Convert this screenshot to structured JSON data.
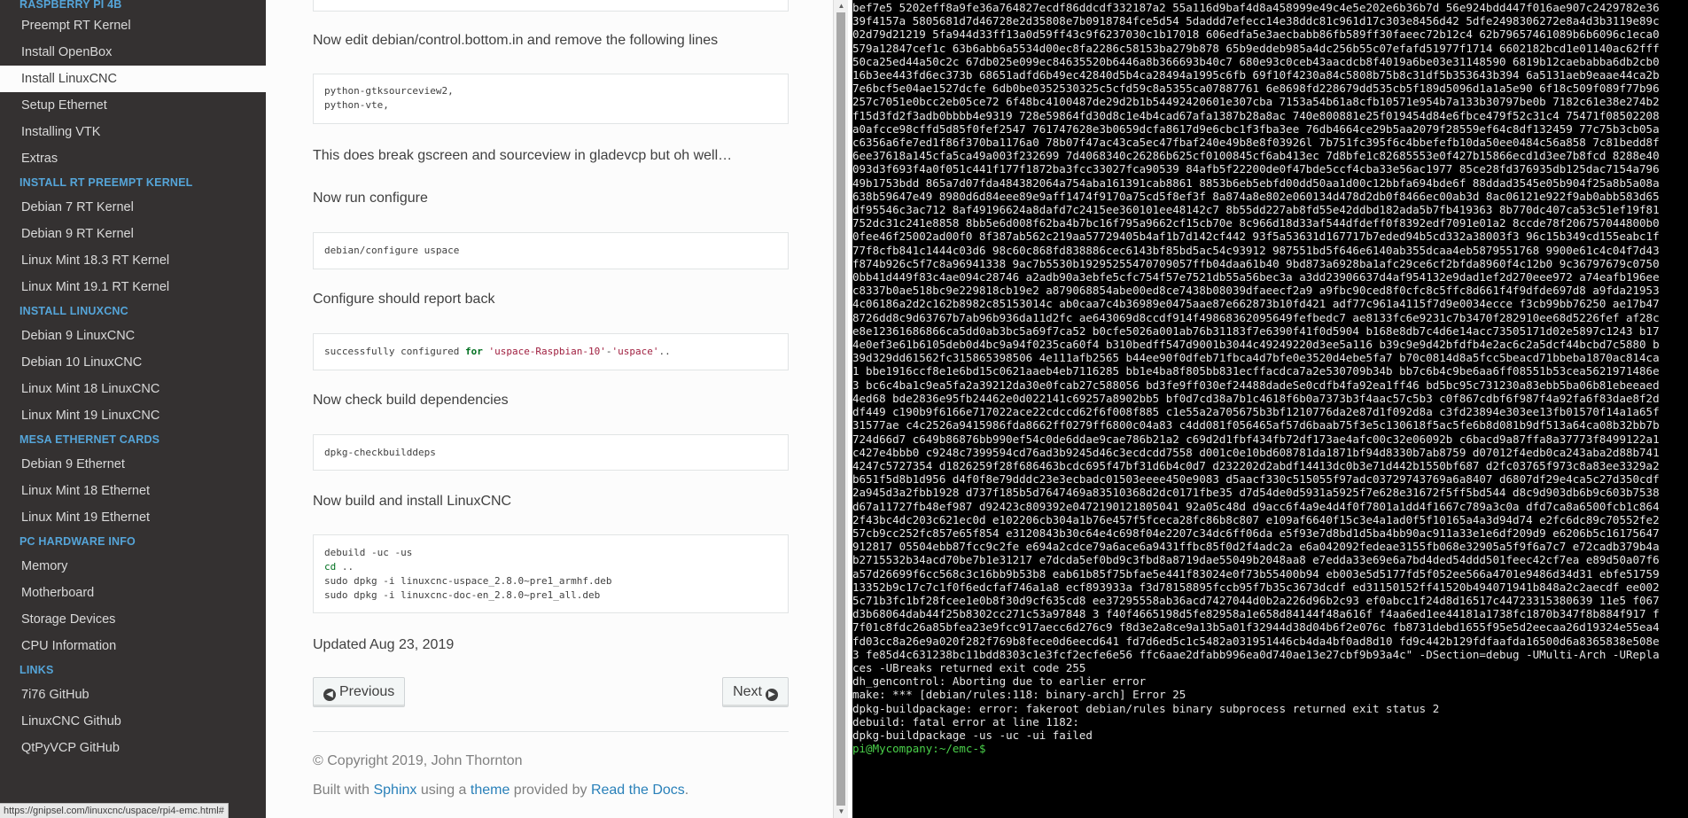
{
  "sidebar": {
    "sections": [
      {
        "caption": "Raspberry Pi 4B",
        "items": [
          {
            "label": "Preempt RT Kernel"
          },
          {
            "label": "Install OpenBox"
          },
          {
            "label": "Install LinuxCNC",
            "current": true
          },
          {
            "label": "Setup Ethernet"
          },
          {
            "label": "Installing VTK"
          },
          {
            "label": "Extras"
          }
        ]
      },
      {
        "caption": "Install RT PREEMPT Kernel",
        "items": [
          {
            "label": "Debian 7 RT Kernel"
          },
          {
            "label": "Debian 9 RT Kernel"
          },
          {
            "label": "Linux Mint 18.3 RT Kernel"
          },
          {
            "label": "Linux Mint 19.1 RT Kernel"
          }
        ]
      },
      {
        "caption": "Install LinuxCNC",
        "items": [
          {
            "label": "Debian 9 LinuxCNC"
          },
          {
            "label": "Debian 10 LinuxCNC"
          },
          {
            "label": "Linux Mint 18 LinuxCNC"
          },
          {
            "label": "Linux Mint 19 LinuxCNC"
          }
        ]
      },
      {
        "caption": "Mesa Ethernet Cards",
        "items": [
          {
            "label": "Debian 9 Ethernet"
          },
          {
            "label": "Linux Mint 18 Ethernet"
          },
          {
            "label": "Linux Mint 19 Ethernet"
          }
        ]
      },
      {
        "caption": "PC Hardware Info",
        "items": [
          {
            "label": "Memory"
          },
          {
            "label": "Motherboard"
          },
          {
            "label": "Storage Devices"
          },
          {
            "label": "CPU Information"
          }
        ]
      },
      {
        "caption": "Links",
        "items": [
          {
            "label": "7i76 GitHub"
          },
          {
            "label": "LinuxCNC Github"
          },
          {
            "label": "QtPyVCP GitHub"
          }
        ]
      }
    ]
  },
  "status_url": "https://gnipsel.com/linuxcnc/uspace/rpi4-emc.html#",
  "content": {
    "p_edit_control": "Now edit debian/control.bottom.in and remove the following lines",
    "code_remove": "python-gtksourceview2,\npython-vte,",
    "p_break": "This does break gscreen and sourceview in gladevcp but oh well…",
    "p_run_configure": "Now run configure",
    "code_configure": "debian/configure uspace",
    "p_report_back": "Configure should report back",
    "code_report": {
      "pre": "successfully configured ",
      "kw": "for",
      "s1": "'uspace-Raspbian-10'",
      "mid": "-",
      "s2": "'uspace'",
      "post": ".."
    },
    "p_check_deps": "Now check build dependencies",
    "code_check": "dpkg-checkbuilddeps",
    "p_build": "Now build and install LinuxCNC",
    "code_build": {
      "line1": "debuild -uc -us",
      "line2_kw": "cd",
      "line2_rest": " ..",
      "line3": "sudo dpkg -i linuxcnc-uspace_2.8.0~pre1_armhf.deb",
      "line4": "sudo dpkg -i linuxcnc-doc-en_2.8.0~pre1_all.deb"
    },
    "updated": "Updated Aug 23, 2019"
  },
  "nav": {
    "previous": "Previous",
    "next": "Next"
  },
  "footer": {
    "copyright": "© Copyright 2019, John Thornton",
    "built_with": "Built with ",
    "sphinx": "Sphinx",
    "using_a": " using a ",
    "theme": "theme",
    "provided_by": " provided by ",
    "rtd": "Read the Docs",
    "period": "."
  },
  "icons": {
    "previous": "circle-arrow-left-icon",
    "next": "circle-arrow-right-icon"
  },
  "colors": {
    "sidebar_bg": "#343131",
    "caption": "#55a5d9",
    "link": "#2980b9",
    "terminal_bg": "#000000",
    "prompt": "#4ad14a"
  },
  "terminal": {
    "hex": "bef7e5 5202eff8a9fe36a764827ecdf86ddcdf332187a2 55a116d9baf4d8a458999e49c4e5e202e6b36b7d 56e924bdd447f016ae907c2429782e3639f4157a 5805681d7d46728e2d35808e7b0918784fce5d54 5daddd7efecc14e38ddc81c961d17c303e8456d42 5dfe2498306272e8a4d3b3119e89c02d79d21219 5fa944d33ff13a0d59ff43c9f6237030c1b17018 606edfa5e3aecbabb86fb589ff30faeec72b12c4 62b79657461089b6b6096c1eca0579a12847cef1c 63b6abb6a5534d00ec8fa2286c58153ba279b878 65b9eddeb985a4dc256b55c07efafd51977f1714 6602182bcd1e01140ac62fff50ca25ed44a50c2c 67db025e099ec84635520b6446a8b366693b40c7 680e93c0ceb43aacdcb8f4019a6be03e31148590 6819b12caebabba6db2cb016b3ee443fd6ec373b 68651adfd6b49ec42840d5b4ca28494a1995c6fb 69f10f4230a84c5808b75b8c31df5b353643b394 6a5131aeb9eaae44ca2b7e6bcf5e04ae1527dcfe 6db0be0352530325c5cfd59c8a5355ca07887761 6e8698fd228679dd535cb5f189d5096d1a1a5e90 6f18c509f089f77b96257c7051e0bcc2eb05ce72 6f48bc4100487de29d2b1b54492420601e307cba 7153a54b61a8cfb10571e954b7a133b30797be0b 7182c61e38e274b2f15d3fd2f3adb0bbbb4e9319 728e59864fd30d8c1e4b4cad67afa1387b28a8ac 740e800881e25f019454d84e6fbce479f52c31c4 75471f08502208a0afcce98cffd5d85f0fef2547 761747628e3b0659dcfa8617d9e6cbc1f3fba3ee 76db4664ce29b5aa2079f28559ef64c8df132459 77c75b3cb05ac6356a6fe7ed1f86f370ba1176a0 78b07f47ac43ca5ec47fbaf240e49b8e8f03926l 7b751fc395f6c4bbefefb10da50ee0484c56a858 7c81bedd8f6ee37618a145cfa5ca49a003f232699 7d4068340c26286b625cf0100845cf6ab413ec 7d8bfe1c82685553e0f427b15866ecd1d3ee7b8fcd 8288e40093d3f693f4a0f051c441f177f1872ba3fcc33027fca90539 84afb5f22200de0f47bde5ccf4cba33e56ac1977 85ce28fd376935db125dac7154a79649b1753bdd 865a7d07fda484382064a754aba161391cab8861 8853b6eb5ebfd00dd50aa1d00c12bbfa694bde6f 88ddad3545e05b904f25a8b5a08a638b59647e49 8980d6d84eee89e9aff1474f9170a75cd5f8ef3f 8a874a8e802e060134d478d2db0f8466ec00ab3d 8ac06121e922f9ab0abb583d65df95546c3ac712 8af49196624a8dafd7c2415ee360101ee48142c7 8b55dd227ab8fd55e42ddbd182ada5b7fb419363 8b770dc407ca53c51ef19f81752dc31c241e8858 8bb5e6d008f62ba4b7bc16f795a9662cf15cb70e 8c966d18d33af544dfdeff0f8392edf7091e01a2 8ccde78f206757044800b00fee46f25002ad00f0 8f387ab562c219aa57729405b4af1b7d142cf442 93f5a53631d167717b7eded94b5cd332a38003f3 96c15b349cd155eabc1f77f8cfb841c1444c03d6 98c60c868fd838886cec6143bf85bd5ac54c93912 987551bd5f646e6140ab355dcaa4eb5879551768 9900e61c4c04f7d43f874b926c5f7c8a96941338 9ac7b5530b19295255470709057ffb04daa61b40 9bd873a6928ba1afc29ce6cf2bfda8960f4c12b0 9c36797679c07500bb41d449f83c4ae094c28746 a2adb90a3ebfe5cfc754f57e7521db55a56bec3a a3dd23906637d4af954132e9dad1ef2d270eee972 a74eafb196eec8337b0ae518bc9e229818cb19e2 a879068854abe00ed8ce7438b08039dfaeecf2a9 a9fbc90ced8f0cfc8c5ffc8d661f4f9dfde697d8 a9fda219534c06186a2d2c162b8982c85153014c ab0caa7c4b36989e0475aae87e662873b10fd421 adf77c961a4115f7d9e0034ecce f3cb99bb76250 ae17b478726dd8c9d63767b7ab96b936da11d2fc ae643069d8ccdf914f49868362095649fefbedc7 ae8133fc6e9231c7b3470f282910ee68d5226fef af28ce8e12361686866ca5dd0ab3bc5a69f7ca52 b0cfe5026a001ab76b31183f7e6390f41f0d5904 b168e8db7c4d6e14acc73505171d02e5897c1243 b174e0ef3e61b6105deb0d4bc9a94f0235ca60f4 b310bedff547d9001b3044c49249220d3ee5a116 b39c9e9d42bfdfb4e2ac6c2a5dcf44bcbd7c5880 b39d329dd61562fc315865398506 4e111afb2565 b44ee90f0dfeb71fbca4d7bfe0e3520d4ebe5fa7 b70c0814d8a5fcc5beacd71bbeba1870ac814ca1 bbe1916ccf8e1e6bd15c0621aaeb4eb7116285 bb1e4ba8f805bb831ecffacdca7a2e530709b34b bb7c6b4c9be6aa6ff08551b53cea5621971486e3 bc6c4ba1c9ea5fa2a39212da30e0fcab27c588056 bd3fe9ff030ef24488dadeSe0cdfb4fa92ea1ff46 bd5bc95c731230a83ebb5ba06b81ebeeaed4ed68 bde2836e95fb24462e0d022141c69257a8902bb5 bf0d7cd38a7b1c4618f6b0a7373b3f4aac57c5b3 c0f867cdbf6f987f4a92fa6f83dae8f2ddf449 c190b9f6166e717022ace22cdccd62f6f008f885 c1e55a2a705675b3bf1210776da2e87d1f092d8a c3fd23894e303ee13fb01570f14a1a65f31577ae c4c2526a9415986fda8662ff0279ff6800c04a83 c4dd081f056465af57d6baab75f3e5c130618f5ac5fe6b8d081b9df513a64ca08b32bb7b724d66d7 c649b86876bb990ef54c0de6ddae9cae786b21a2 c69d2d1fbf434fb72df173ae4afc00c32e06092b c6bacd9a87ffa8a37773f8499122a1c427e4bbb0 c9248c7399594cd76ad3b9245d46c3ecdcdd7558 d001c0e10bd608781da1871bf94d8330b7ab8759 d07012f4edb0ca243aba2d88b7414247c5727354 d1826259f28f686463bcdc695f47bf31d6b4c0d7 d232202d2abdf14413dc0b3e71d442b1550bf687 d2fc03765f973c8a83ee3329a2b651f5d8b1d956 d4f0f8e79dddc23e3ecbadc01503eeee450e9083 d5aacf330c515055f97adc03729743769a6a8407 d6807df29e4ca5c27d350cdf2a945d3a2fbb1928 d737f185b5d7647469a83510368d2dc0171fbe35 d7d54de0d5931a5925f7e628e31672f5ff5bd544 d8c9d903db6b9c603b7538d67a11727fb48ef987 d92423c809392e0472190121805041 92a05c48d d9acc6f4a9e4d4f0f7801a1dd4f1667c789a3c0a dfd7ca8a6500fcb1c8642f43bc4dc203c621ec0d e102206cb304a1b76e457f5fceca28fc86b8c807 e109af6640f15c3e4a1ad0f5f10165a4a3d94d74 e2fc6dc89c70552fe257cb9cc252fc857e65f854 e3120843b30c64e4c698f04e2207c34dc6ff06da e5f93e7d8bd1d5ba4bb90ac911a33e1e6df209d9 e6206b5c16175647912817 05504ebb87fcc9c2fe e694a2cdce79a6ace6a9431ffbc85f0d2f4adc2a e6a042092fedeae3155fb068e32905a5f9f6a7c7 e72cadb379b4ab2715532b34acd70be7b1e31217 e7dcda5ef0bd9c3fbd8a8719dae55049b2048aa8 e7edda33e69e6a7bd4ded54ddd501feec42cf7ea e89d50a07f6a57d26699f6cc568c3c16bb9b53b8 eab61b85f75bfae5e441f83024e0f73b55400b94 eb003e5d5177fd5f052ee566a4701e9486d34d31 ebfe5175913352b9c17c7c1f0f6edcfaf746a1a8 ecf893933a f3d78158895fccb95f7b35c3673dcdf ed31150152ff41520b494071941b848a2c2aecdf ee0025c71b3fc1bf28fcee1e0b8f30d9cf635cd8 ee37295558ab36acd7427044d0b2a226d96b2c93 ef0abcc1f24d8d16517c44723315380639 11e5 f067d3b68064dab44f25b8302cc271c53a97848 3 f40f4665198d5fe82958a1e658d84144f48a616f f4aa6ed1ee44181a1738fc1870b347f8b884f917 f7f01c8fdc26a85bfea23e9fcc917aecc6d276c9 f8d3e2a8ce9a13b5a01f32944d38d04b6f2e076c fb8731debd1655f95e5d2eecaa26d19324e55ea4 fd03cc8a26e9a020f282f769b8fece0d6eecd641 fd7d6ed5c1c5482a031951446cb4da4bf0ad8d10 fd9c442b129fdfaafda16500d6a8365838e508e3 fe85d4c631238bc11bdd8303c1e3fcf2ecfe6e56 ffc6aae2dfabb996ea0d740ae13e27cbf9b93a4c\" -DSection=debug -UMulti-Arch -UReplaces -UBreaks returned exit code 255",
    "lines": [
      "dh_gencontrol: Aborting due to earlier error",
      "make: *** [debian/rules:118: binary-arch] Error 25",
      "dpkg-buildpackage: error: fakeroot debian/rules binary subprocess returned exit status 2",
      "debuild: fatal error at line 1182:",
      "dpkg-buildpackage -us -uc -ui failed"
    ],
    "prompt": "pi@Mycompany:~/emc-$"
  }
}
